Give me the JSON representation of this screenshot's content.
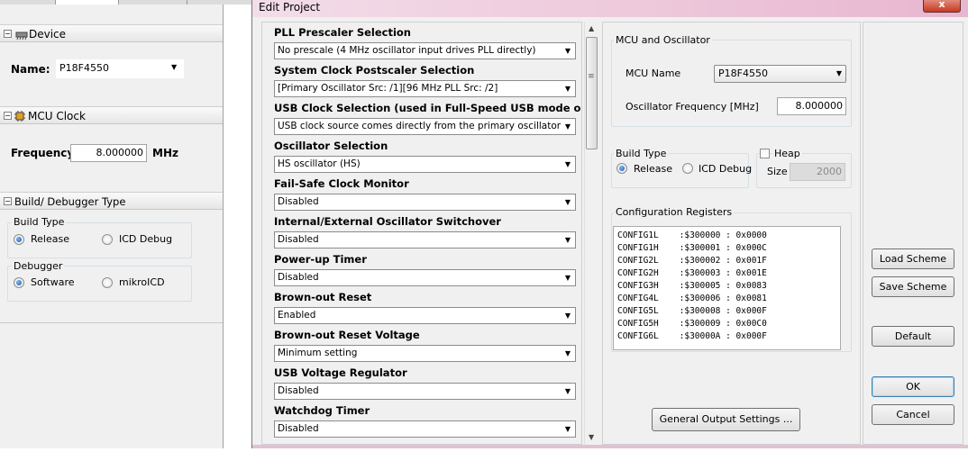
{
  "left_panel": {
    "device_section": "Device",
    "name_label": "Name:",
    "name_value": "P18F4550",
    "mcu_clock_section": "MCU Clock",
    "frequency_label": "Frequency:",
    "frequency_value": "8.000000",
    "frequency_unit": "MHz",
    "build_section": "Build/ Debugger Type",
    "build_type_group": "Build Type",
    "build_release": "Release",
    "build_icd": "ICD Debug",
    "debugger_group": "Debugger",
    "debugger_software": "Software",
    "debugger_mikroicd": "mikroICD"
  },
  "dialog": {
    "title": "Edit Project",
    "close_label": "x",
    "options": [
      {
        "label": "PLL Prescaler Selection",
        "value": "No prescale (4 MHz oscillator input drives PLL directly)"
      },
      {
        "label": "System Clock Postscaler Selection",
        "value": "[Primary Oscillator Src: /1][96 MHz PLL Src: /2]"
      },
      {
        "label": "USB Clock Selection (used in Full-Speed USB mode onl...",
        "value": "USB clock source comes directly from the primary oscillator block with no postscale"
      },
      {
        "label": "Oscillator Selection",
        "value": "HS oscillator (HS)"
      },
      {
        "label": "Fail-Safe Clock Monitor",
        "value": "Disabled"
      },
      {
        "label": "Internal/External Oscillator Switchover",
        "value": "Disabled"
      },
      {
        "label": "Power-up Timer",
        "value": "Disabled"
      },
      {
        "label": "Brown-out Reset",
        "value": "Enabled"
      },
      {
        "label": "Brown-out Reset Voltage",
        "value": "Minimum setting"
      },
      {
        "label": "USB Voltage Regulator",
        "value": "Disabled"
      },
      {
        "label": "Watchdog Timer",
        "value": "Disabled"
      }
    ],
    "mcu_osc_group": "MCU and Oscillator",
    "mcu_name_label": "MCU Name",
    "mcu_name_value": "P18F4550",
    "osc_freq_label": "Oscillator Frequency [MHz]",
    "osc_freq_value": "8.000000",
    "build_type_group": "Build Type",
    "build_release": "Release",
    "build_icd": "ICD Debug",
    "heap_label": "Heap",
    "size_label": "Size",
    "size_value": "2000",
    "config_group": "Configuration Registers",
    "config_registers": [
      "CONFIG1L    :$300000 : 0x0000",
      "CONFIG1H    :$300001 : 0x000C",
      "CONFIG2L    :$300002 : 0x001F",
      "CONFIG2H    :$300003 : 0x001E",
      "CONFIG3H    :$300005 : 0x0083",
      "CONFIG4L    :$300006 : 0x0081",
      "CONFIG5L    :$300008 : 0x000F",
      "CONFIG5H    :$300009 : 0x00C0",
      "CONFIG6L    :$30000A : 0x000F"
    ],
    "general_output_button": "General Output Settings ...",
    "load_scheme_button": "Load Scheme",
    "save_scheme_button": "Save Scheme",
    "default_button": "Default",
    "ok_button": "OK",
    "cancel_button": "Cancel"
  }
}
